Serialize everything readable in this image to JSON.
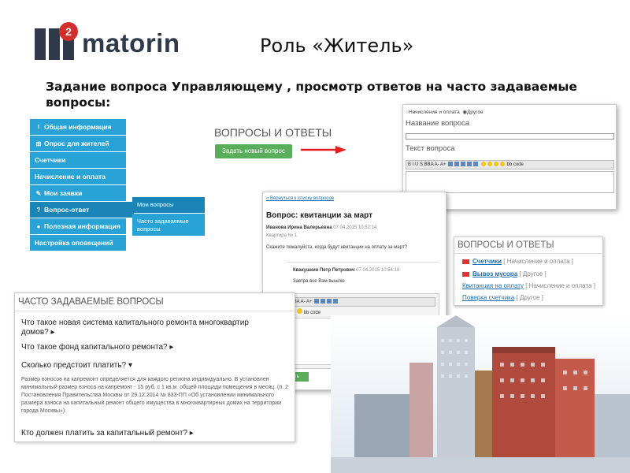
{
  "logo": {
    "text": "matorin",
    "mark_text": "2"
  },
  "slide": {
    "title": "Роль «Житель»",
    "subtitle": "Задание вопроса Управляющему , просмотр ответов на часто задаваемые вопросы:"
  },
  "menu": {
    "items": [
      {
        "icon": "!",
        "label": "Общая информация"
      },
      {
        "icon": "⊞",
        "label": "Опрос для жителей"
      },
      {
        "icon": "",
        "label": "Счетчики"
      },
      {
        "icon": "",
        "label": "Начисление и оплата"
      },
      {
        "icon": "✎",
        "label": "Мои заявки"
      },
      {
        "icon": "?",
        "label": "Вопрос-ответ"
      },
      {
        "icon": "●",
        "label": "Полезная информация"
      },
      {
        "icon": "",
        "label": "Настройка оповещений"
      }
    ],
    "submenu": [
      "Мои вопросы",
      "Часто задаваемые вопросы"
    ]
  },
  "qa": {
    "title": "ВОПРОСЫ И ОТВЕТЫ",
    "ask_button": "Задать новый вопрос"
  },
  "form": {
    "radio1": "Начисления и оплата",
    "radio2": "Другое",
    "name_label": "Название вопроса",
    "text_label": "Текст вопроса",
    "toolbar": "B I U S BBA A- A+",
    "toolbar_code": "bb code"
  },
  "question": {
    "back_link": "« Вернуться к списку вопросов",
    "prefix": "Вопрос:",
    "subject": "квитанции за март",
    "author": "Иванова Ирина Валерьевна",
    "author_date": "07.04.2015 10:52:14",
    "apartment": "Квартира № 1",
    "text": "Скажите пожалуйста, когда будут квитанции на оплату за март?",
    "reply_author": "Квакушкин Петр Петрович",
    "reply_date": "07.04.2015 10:54:10",
    "reply_text": "Завтра все Вам вышлю",
    "toolbar": "B I U S BBA A- A+",
    "toolbar_code": "bb code",
    "send_button": "Ответить"
  },
  "list": {
    "title": "ВОПРОСЫ И ОТВЕТЫ",
    "rows": [
      {
        "link": "Счетчики",
        "category": "[ Начисление и оплата ]",
        "unread": true
      },
      {
        "link": "Вывоз мусора",
        "category": "[ Другое ]",
        "unread": true
      },
      {
        "link": "Квитанция на оплату",
        "category": "[ Начисление и оплата ]",
        "unread": false
      },
      {
        "link": "Поверка счетчика",
        "category": "[ Другое ]",
        "unread": false
      }
    ]
  },
  "faq": {
    "title": "ЧАСТО ЗАДАВАЕМЫЕ ВОПРОСЫ",
    "q1": "Что такое новая система капитального ремонта многоквартир",
    "q1b": "домов?",
    "q2": "Что такое фонд капитального ремонта?",
    "q3": "Сколько предстоит платить?",
    "answer": "Размер взносов на капремонт определяется для каждого региона индивидуально. В установлен минимальный размер взноса на капремонт - 15 руб. с 1 кв.м. общей площади помещения в месяц. (п. 2 Постановления Правительства Москвы от 29.12.2014 № 833-ПП «Об установлении минимального размера взноса на капитальный ремонт общего имущества в многоквартирных домах на территории города Москвы»).",
    "q4": "Кто должен платить за капитальный ремонт?"
  },
  "colors": {
    "menu": "#29a3d6",
    "menu_active": "#1b85b8",
    "button": "#5aad5a",
    "logo_red": "#d32f2f",
    "logo_dark": "#2e3a4a"
  }
}
